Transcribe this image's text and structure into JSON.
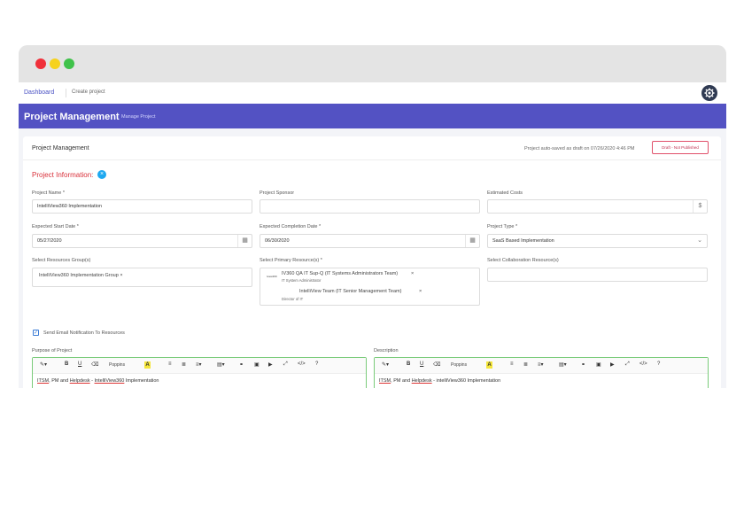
{
  "nav": {
    "home": "Dashboard",
    "current": "Create project"
  },
  "banner": {
    "title": "Project Management",
    "subtitle": "Manage Project"
  },
  "card": {
    "title": "Project Management",
    "autosave": "Project auto-saved as draft on 07/26/2020 4:46 PM",
    "badge": "Draft - Not Published"
  },
  "section": {
    "title": "Project Information:",
    "close_icon": "×"
  },
  "fields": {
    "project_name": {
      "label": "Project Name *",
      "value": "IntelliView360 Implementation"
    },
    "sponsor": {
      "label": "Project Sponsor",
      "value": ""
    },
    "costs": {
      "label": "Estimated Costs",
      "value": ""
    },
    "start": {
      "label": "Expected Start Date *",
      "value": "05/27/2020"
    },
    "completion": {
      "label": "Expected Completion Date *",
      "value": "06/30/2020"
    },
    "type": {
      "label": "Project Type *",
      "value": "SaaS Based Implementation"
    },
    "res_group": {
      "label": "Select Resources Group(s)",
      "chip": "IntelliView360 Implementation Group"
    },
    "primary": {
      "label": "Select Primary Resource(s) *",
      "items": [
        {
          "logo": "iview360",
          "name": "IV360 QA IT Sup-Q (IT Systems Administrators Team)",
          "role": "IT System Administrator"
        },
        {
          "logo": "",
          "name": "IntelliView Team (IT Senior Management Team)",
          "role": "Director of IT"
        }
      ]
    },
    "collab": {
      "label": "Select Collaboration Resource(s)"
    }
  },
  "notify": {
    "label": "Send Email Notification To Resources",
    "checked": true
  },
  "purpose": {
    "label": "Purpose of Project",
    "font": "Poppins",
    "text": {
      "a": "ITSM",
      "b": ", PM and ",
      "c": "Helpdesk",
      "d": " - ",
      "e": "IntelliView360",
      "f": " Implementation"
    }
  },
  "description": {
    "label": "Description",
    "font": "Poppins",
    "text": {
      "a": "ITSM",
      "b": ", PM and ",
      "c": "Helpdesk",
      "d": " - intelliView360 Implementation"
    }
  },
  "toolbar": {
    "b": "B",
    "u": "U",
    "hl": "A",
    "code": "</>",
    "help": "?"
  },
  "colors": {
    "accent": "#5352c3",
    "draft": "#e0506a",
    "required": "#d9303a"
  }
}
